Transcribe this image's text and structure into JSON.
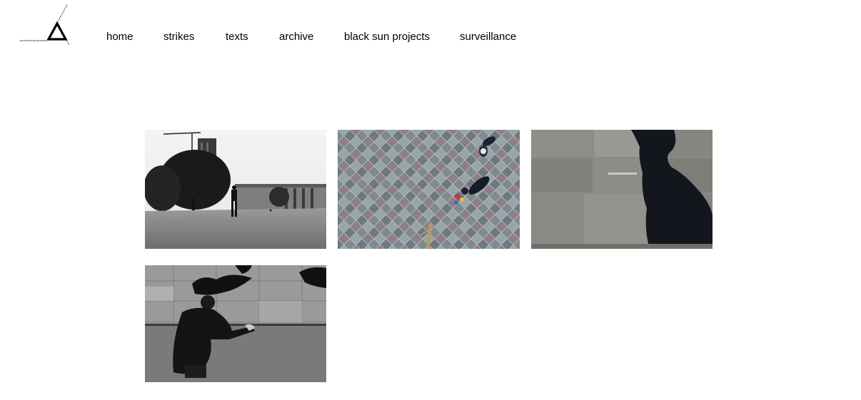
{
  "nav": {
    "items": [
      {
        "label": "home"
      },
      {
        "label": "strikes"
      },
      {
        "label": "texts"
      },
      {
        "label": "archive"
      },
      {
        "label": "black sun projects"
      },
      {
        "label": "surveillance"
      }
    ]
  },
  "gallery": {
    "items": [
      {
        "subject": "square-plaza-bw"
      },
      {
        "subject": "aerial-diamond-pavement"
      },
      {
        "subject": "shadow-on-stone-tiles"
      },
      {
        "subject": "man-crouching-on-pavement-bw"
      }
    ]
  },
  "colors": {
    "background": "#ffffff",
    "text": "#000000"
  },
  "icons": {
    "logo": "triangle-logo-icon"
  }
}
